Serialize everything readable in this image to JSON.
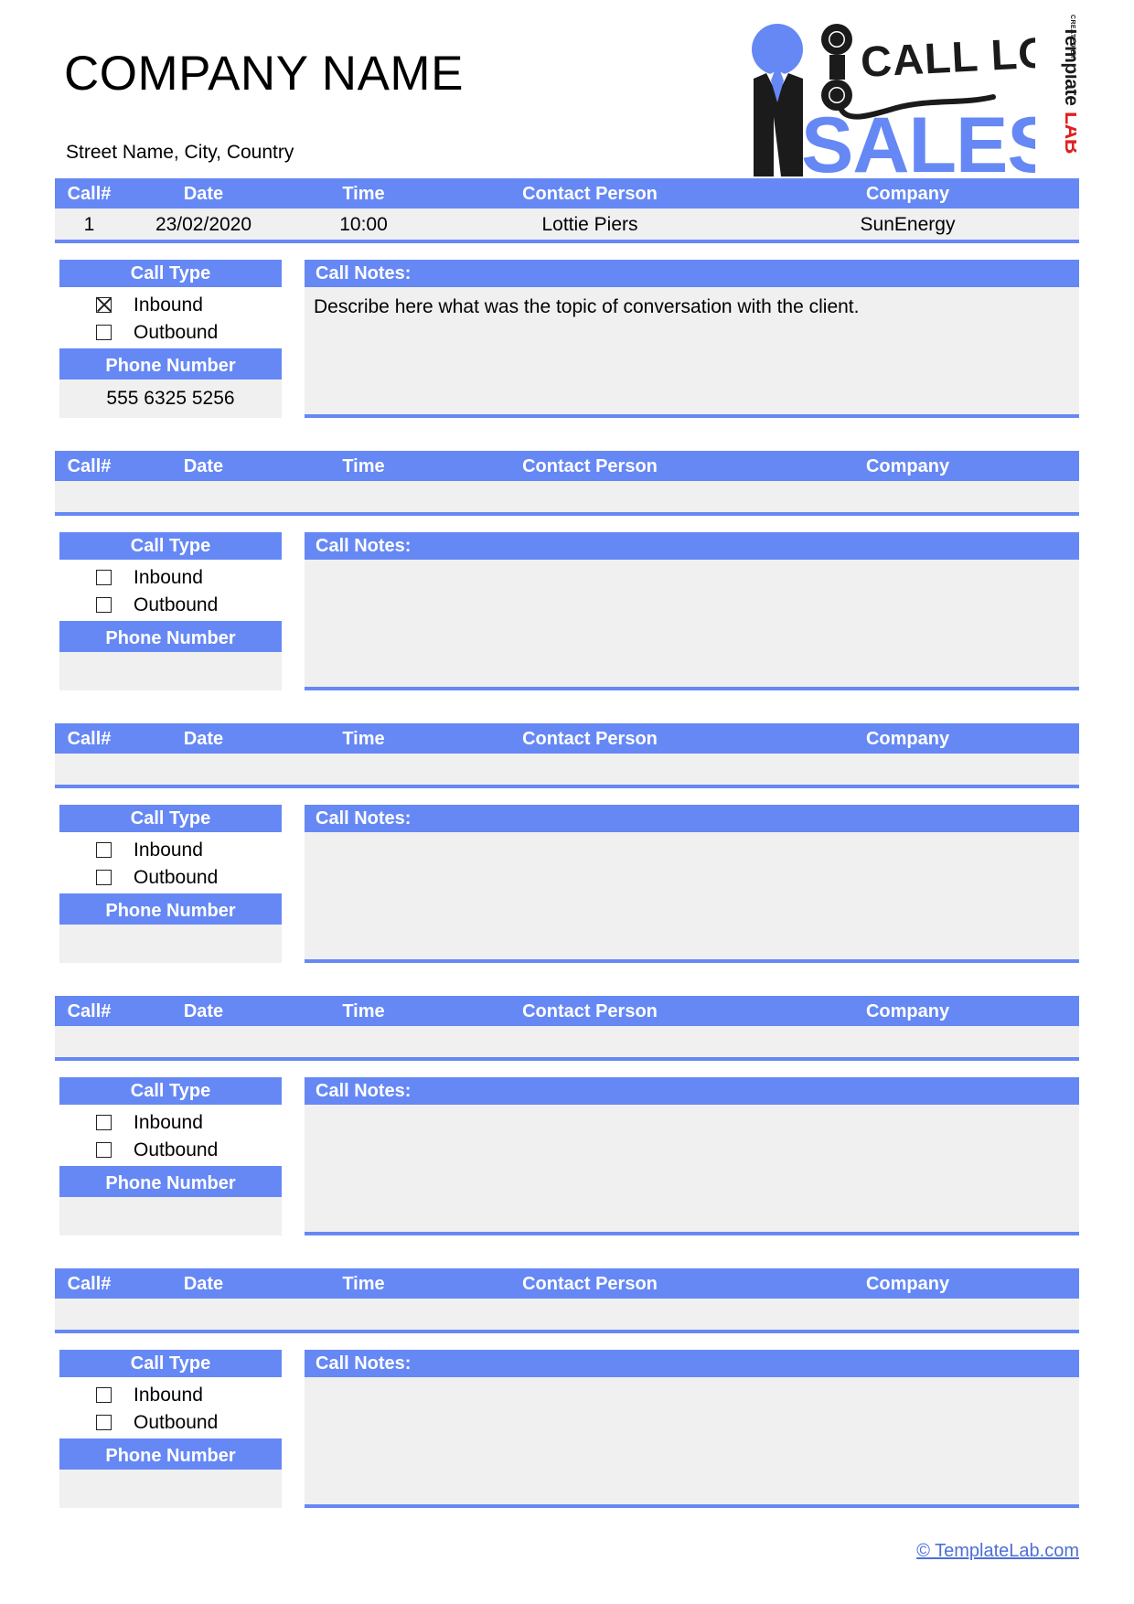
{
  "header": {
    "company_name": "COMPANY NAME",
    "address": "Street Name, City, Country",
    "logo": {
      "call_log_text": "CALL LOG",
      "sales_text": "SALES",
      "accent_color": "#6688f5",
      "dark_color": "#1b1b1b"
    },
    "watermark": {
      "created_by": "CREATED BY",
      "template": "Template",
      "lab": "LAB",
      "lab_color": "#e02020"
    }
  },
  "columns": {
    "call_number": "Call#",
    "date": "Date",
    "time": "Time",
    "contact_person": "Contact Person",
    "company": "Company"
  },
  "labels": {
    "call_type": "Call Type",
    "inbound": "Inbound",
    "outbound": "Outbound",
    "phone_number": "Phone Number",
    "call_notes": "Call Notes:"
  },
  "entries": [
    {
      "call_number": "1",
      "date": "23/02/2020",
      "time": "10:00",
      "contact_person": "Lottie Piers",
      "company": "SunEnergy",
      "inbound_checked": true,
      "outbound_checked": false,
      "phone_number": "555 6325 5256",
      "notes": "Describe here what was the topic of conversation with the client."
    },
    {
      "call_number": "",
      "date": "",
      "time": "",
      "contact_person": "",
      "company": "",
      "inbound_checked": false,
      "outbound_checked": false,
      "phone_number": "",
      "notes": ""
    },
    {
      "call_number": "",
      "date": "",
      "time": "",
      "contact_person": "",
      "company": "",
      "inbound_checked": false,
      "outbound_checked": false,
      "phone_number": "",
      "notes": ""
    },
    {
      "call_number": "",
      "date": "",
      "time": "",
      "contact_person": "",
      "company": "",
      "inbound_checked": false,
      "outbound_checked": false,
      "phone_number": "",
      "notes": ""
    },
    {
      "call_number": "",
      "date": "",
      "time": "",
      "contact_person": "",
      "company": "",
      "inbound_checked": false,
      "outbound_checked": false,
      "phone_number": "",
      "notes": ""
    }
  ],
  "footer": {
    "copyright": "© TemplateLab.com"
  },
  "theme": {
    "accent": "#6688f5",
    "field_bg": "#f0f0f0"
  }
}
